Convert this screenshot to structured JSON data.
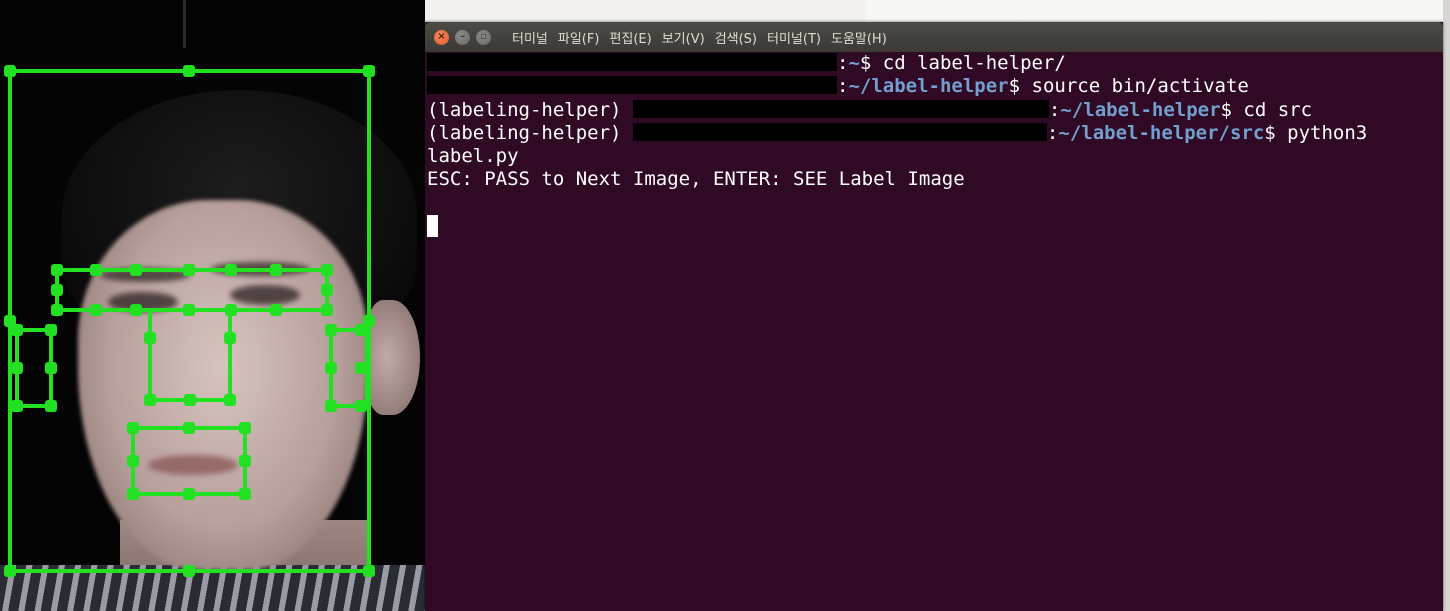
{
  "terminal": {
    "menu": [
      {
        "label": "터미널"
      },
      {
        "label": "파일(F)"
      },
      {
        "label": "편집(E)"
      },
      {
        "label": "보기(V)"
      },
      {
        "label": "검색(S)"
      },
      {
        "label": "터미널(T)"
      },
      {
        "label": "도움말(H)"
      }
    ],
    "lines": {
      "l1_cmd": "cd label-helper/",
      "l1_path": "~",
      "l2_path": "~/label-helper",
      "l2_cmd": "source bin/activate",
      "l3_env": "(labeling-helper)",
      "l3_path": "~/label-helper",
      "l3_cmd": "cd src",
      "l4_env": "(labeling-helper)",
      "l4_path": "~/label-helper/src",
      "l4_cmd": "python3",
      "l5": "label.py",
      "l6": "ESC: PASS to Next Image, ENTER: SEE Label Image"
    },
    "colors": {
      "background": "#300a24",
      "text": "#ffffff",
      "path": "#729fcf",
      "overlay_green": "#22e022"
    }
  }
}
